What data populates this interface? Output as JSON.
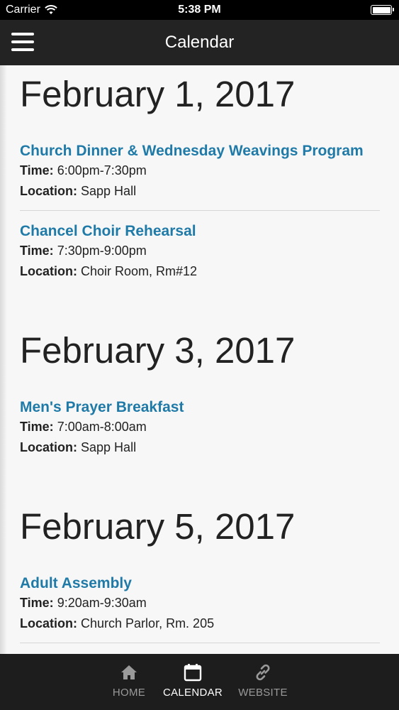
{
  "status_bar": {
    "carrier": "Carrier",
    "time": "5:38 PM"
  },
  "nav": {
    "title": "Calendar"
  },
  "days": [
    {
      "date": "February 1, 2017",
      "events": [
        {
          "title": "Church Dinner & Wednesday Weavings Program",
          "time_label": "Time:",
          "time": "6:00pm-7:30pm",
          "location_label": "Location:",
          "location": "Sapp Hall"
        },
        {
          "title": "Chancel Choir Rehearsal",
          "time_label": "Time:",
          "time": "7:30pm-9:00pm",
          "location_label": "Location:",
          "location": "Choir Room, Rm#12"
        }
      ]
    },
    {
      "date": "February 3, 2017",
      "events": [
        {
          "title": "Men's Prayer Breakfast",
          "time_label": "Time:",
          "time": "7:00am-8:00am",
          "location_label": "Location:",
          "location": "Sapp Hall"
        }
      ]
    },
    {
      "date": "February 5, 2017",
      "events": [
        {
          "title": "Adult Assembly",
          "time_label": "Time:",
          "time": "9:20am-9:30am",
          "location_label": "Location:",
          "location": "Church Parlor, Rm. 205"
        }
      ]
    }
  ],
  "tabs": [
    {
      "label": "HOME",
      "icon": "home-icon",
      "active": false
    },
    {
      "label": "CALENDAR",
      "icon": "calendar-icon",
      "active": true
    },
    {
      "label": "WEBSITE",
      "icon": "link-icon",
      "active": false
    }
  ],
  "colors": {
    "event_title": "#1f7aa8",
    "nav_bg": "#232323",
    "tab_bg": "#1d1d1d",
    "tab_active": "#ffffff",
    "tab_inactive": "#9a9a9a"
  }
}
